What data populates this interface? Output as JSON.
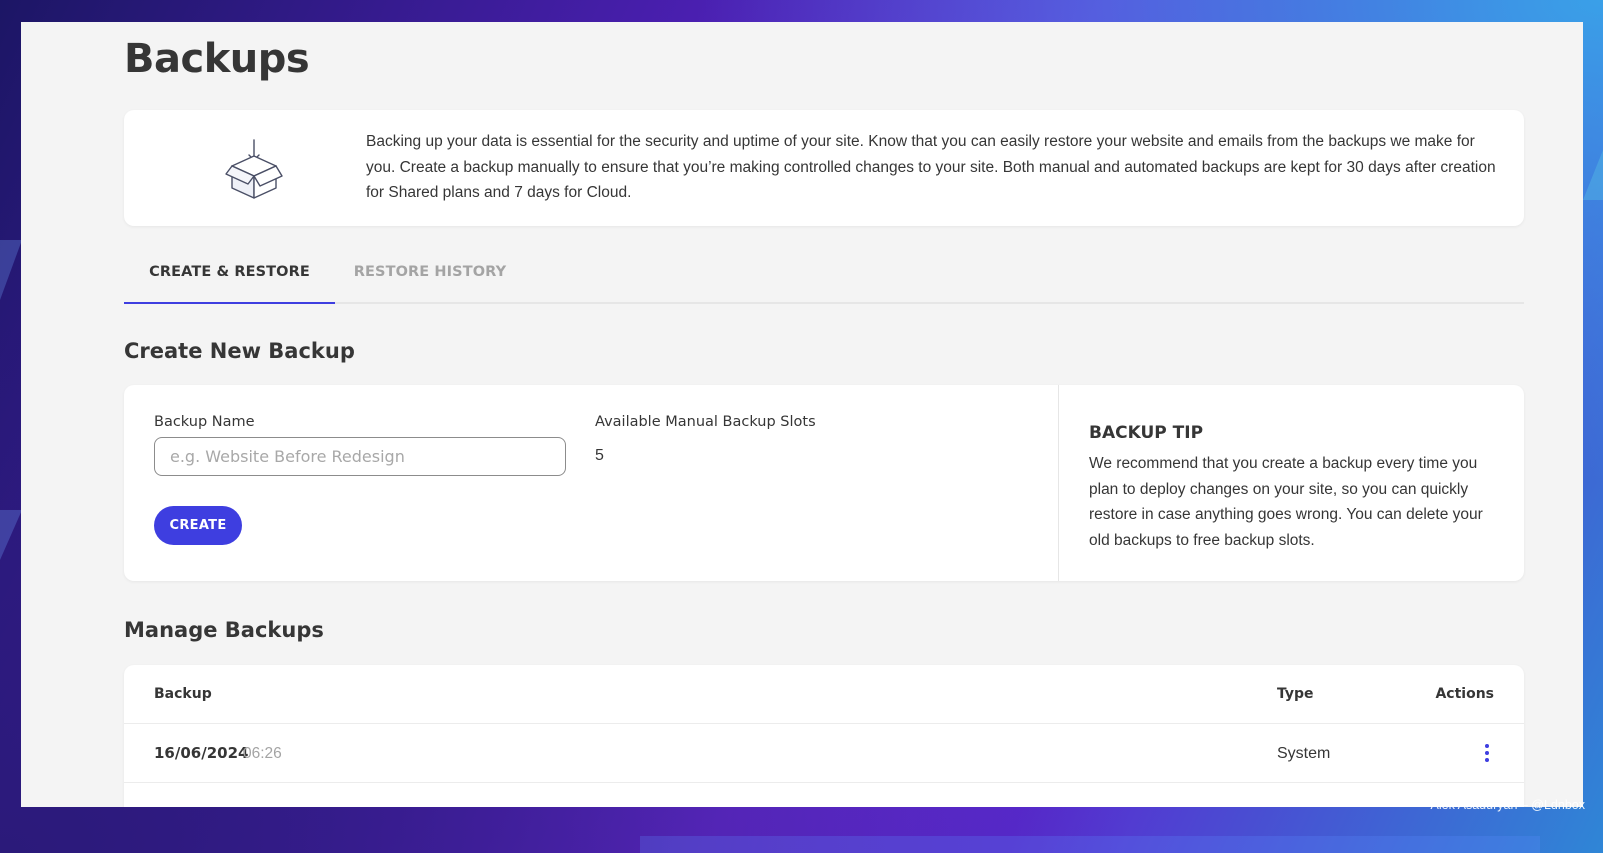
{
  "page": {
    "title": "Backups"
  },
  "intro": {
    "icon": "open-box-download-icon",
    "text": "Backing up your data is essential for the security and uptime of your site. Know that you can easily restore your website and emails from the backups we make for you. Create a backup manually to ensure that you’re making controlled changes to your site. Both manual and automated backups are kept for 30 days after creation for Shared plans and 7 days for Cloud."
  },
  "tabs": [
    {
      "label": "CREATE & RESTORE",
      "active": true
    },
    {
      "label": "RESTORE HISTORY",
      "active": false
    }
  ],
  "create": {
    "section_title": "Create New Backup",
    "name_label": "Backup Name",
    "name_placeholder": "e.g. Website Before Redesign",
    "name_value": "",
    "slots_label": "Available Manual Backup Slots",
    "slots_value": "5",
    "button_label": "CREATE"
  },
  "tip": {
    "title": "BACKUP TIP",
    "text": "We recommend that you create a backup every time you plan to deploy changes on your site, so you can quickly restore in case anything goes wrong. You can delete your old backups to free backup slots."
  },
  "manage": {
    "section_title": "Manage Backups",
    "columns": {
      "backup": "Backup",
      "type": "Type",
      "actions": "Actions"
    },
    "rows": [
      {
        "date": "16/06/2024",
        "time": "06:26",
        "type": "System",
        "actions_icon": "kebab-menu-icon"
      }
    ]
  },
  "colors": {
    "accent": "#3e3ee0",
    "text": "#363636",
    "muted": "#a4a4a4",
    "page_bg": "#f4f4f4",
    "card_bg": "#ffffff"
  },
  "credit": "Alek Asaduryan – @Ldnbox"
}
